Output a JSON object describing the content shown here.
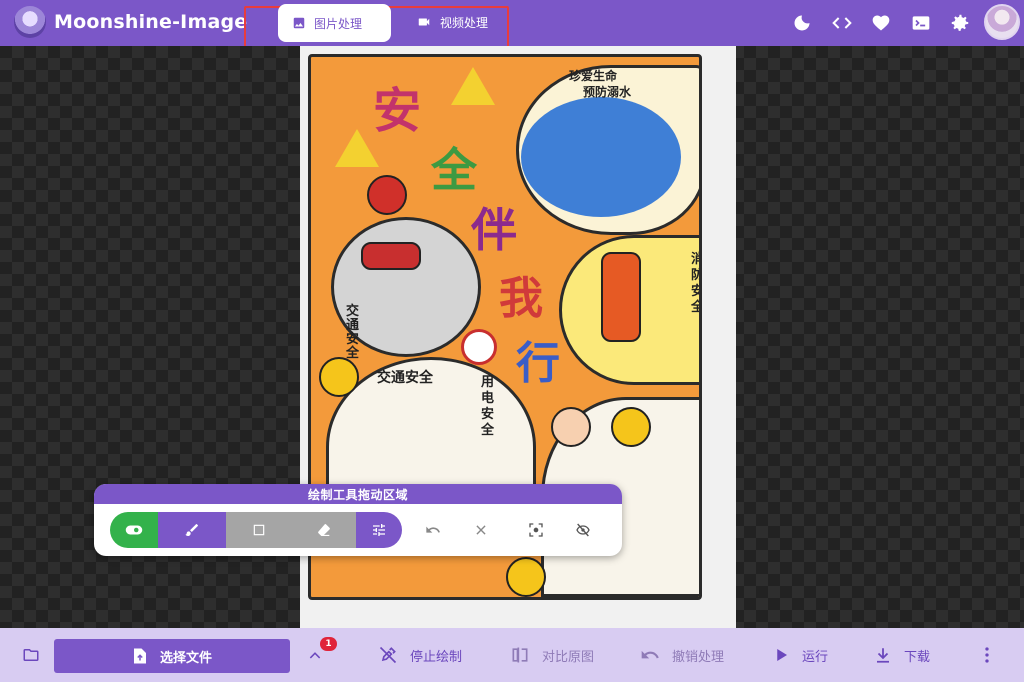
{
  "header": {
    "app_title": "Moonshine-Image",
    "tabs": [
      {
        "label": "图片处理",
        "icon": "image-icon",
        "active": true
      },
      {
        "label": "视频处理",
        "icon": "video-icon",
        "active": false
      }
    ],
    "icons": [
      "moon-icon",
      "code-icon",
      "heart-icon",
      "terminal-icon",
      "gear-icon",
      "avatar"
    ]
  },
  "poster": {
    "title_chars": [
      "安",
      "全",
      "伴",
      "我",
      "行"
    ],
    "texts": {
      "cherish": "珍爱生命",
      "drowning": "预防溺水",
      "fire": "消防安全",
      "traffic": "交通安全",
      "traffic_v": "交通安全",
      "electric": "用电安全"
    }
  },
  "draw_panel": {
    "drag_label": "绘制工具拖动区域",
    "tools": [
      "toggle-icon",
      "brush-icon",
      "rectangle-icon",
      "eraser-icon",
      "tune-icon",
      "undo-icon",
      "close-icon",
      "focus-icon",
      "eye-off-icon"
    ]
  },
  "bottom_bar": {
    "choose_file": "选择文件",
    "badge_count": "1",
    "actions": [
      {
        "label": "停止绘制",
        "icon": "draw-off-icon",
        "enabled": true
      },
      {
        "label": "对比原图",
        "icon": "compare-icon",
        "enabled": false
      },
      {
        "label": "撤销处理",
        "icon": "undo-icon",
        "enabled": false
      },
      {
        "label": "运行",
        "icon": "play-icon",
        "enabled": true
      },
      {
        "label": "下载",
        "icon": "download-icon",
        "enabled": true
      }
    ]
  },
  "colors": {
    "primary": "#7b57c8",
    "bottom_bar": "#d8ccf2",
    "tab_highlight_border": "#e83c3c",
    "toggle_green": "#33b24b",
    "badge_red": "#e0243a"
  }
}
